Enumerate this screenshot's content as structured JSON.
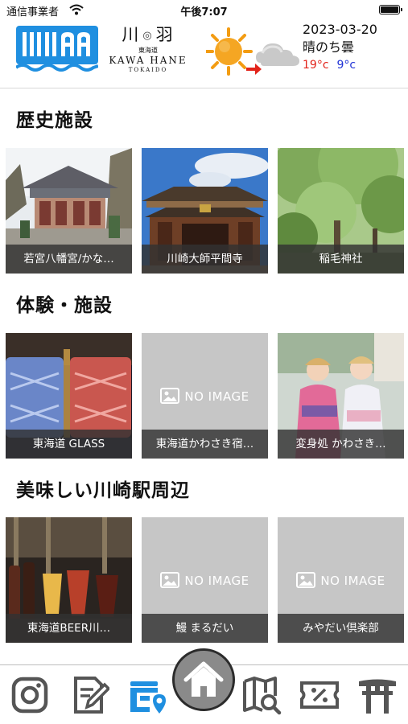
{
  "status_bar": {
    "carrier": "通信事業者",
    "time": "午後7:07"
  },
  "header": {
    "brand_kanji_left": "川",
    "brand_kanji_right": "羽",
    "brand_sub": "東海道",
    "brand_roman": "KAWA HANE",
    "brand_region": "TOKAIDO",
    "weather": {
      "date": "2023-03-20",
      "description": "晴のち曇",
      "high": "19°c",
      "low": "9°c",
      "icons": [
        "sun-icon",
        "arrow-right-icon",
        "cloud-icon"
      ]
    }
  },
  "sections": [
    {
      "title": "歴史施設",
      "cards": [
        {
          "caption": "若宮八幡宮/かな…",
          "image": "shrine-photo"
        },
        {
          "caption": "川崎大師平間寺",
          "image": "temple-photo"
        },
        {
          "caption": "稲毛神社",
          "image": "trees-photo"
        }
      ]
    },
    {
      "title": "体験・施設",
      "cards": [
        {
          "caption": "東海道 GLASS",
          "image": "glass-photo"
        },
        {
          "caption": "東海道かわさき宿…",
          "image": "none"
        },
        {
          "caption": "変身処 かわさき…",
          "image": "kimono-photo"
        }
      ]
    },
    {
      "title": "美味しい川崎駅周辺",
      "cards": [
        {
          "caption": "東海道BEER川…",
          "image": "beer-photo"
        },
        {
          "caption": "鰻 まるだい",
          "image": "none"
        },
        {
          "caption": "みやだい倶楽部",
          "image": "none"
        }
      ]
    }
  ],
  "no_image_label": "NO IMAGE",
  "tabbar": {
    "items": [
      "instagram-icon",
      "notes-icon",
      "spots-icon",
      "home-icon",
      "map-search-icon",
      "coupon-icon",
      "torii-icon"
    ],
    "active": "spots-icon"
  },
  "colors": {
    "accent": "#1f8fe0",
    "caption_bg": "#323232",
    "noimg_bg": "#c6c6c6",
    "temp_high": "#e2231a",
    "temp_low": "#2134d6"
  }
}
